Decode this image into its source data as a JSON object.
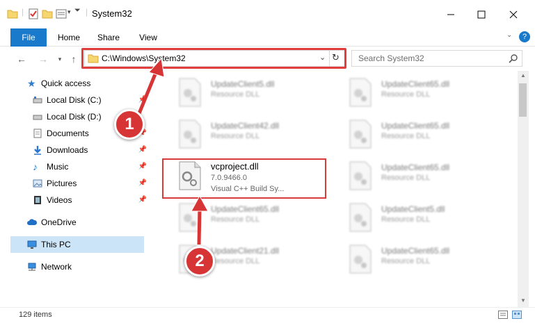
{
  "window": {
    "title": "System32"
  },
  "ribbon": {
    "tabs": [
      "File",
      "Home",
      "Share",
      "View"
    ]
  },
  "address": {
    "path": "C:\\Windows\\System32"
  },
  "search": {
    "placeholder": "Search System32"
  },
  "sidebar": {
    "items": [
      {
        "label": "Quick access"
      },
      {
        "label": "Local Disk (C:)"
      },
      {
        "label": "Local Disk (D:)"
      },
      {
        "label": "Documents"
      },
      {
        "label": "Downloads"
      },
      {
        "label": "Music"
      },
      {
        "label": "Pictures"
      },
      {
        "label": "Videos"
      },
      {
        "label": "OneDrive"
      },
      {
        "label": "This PC"
      },
      {
        "label": "Network"
      }
    ]
  },
  "files": {
    "left": [
      {
        "name": "UpdateClient5.dll",
        "desc": "Resource DLL"
      },
      {
        "name": "UpdateClient42.dll",
        "desc": "Resource DLL"
      },
      {
        "name": "vcproject.dll",
        "version": "7.0.9466.0",
        "desc": "Visual C++ Build Sy..."
      },
      {
        "name": "UpdateClient65.dll",
        "desc": "Resource DLL"
      },
      {
        "name": "UpdateClient21.dll",
        "desc": "Resource DLL"
      }
    ],
    "right": [
      {
        "name": "UpdateClient65.dll",
        "desc": "Resource DLL"
      },
      {
        "name": "UpdateClient65.dll",
        "desc": "Resource DLL"
      },
      {
        "name": "UpdateClient65.dll",
        "desc": "Resource DLL"
      },
      {
        "name": "UpdateClient5.dll",
        "desc": "Resource DLL"
      },
      {
        "name": "UpdateClient65.dll",
        "desc": "Resource DLL"
      }
    ]
  },
  "status": {
    "items_count": "129 items"
  },
  "annotations": {
    "step1": "1",
    "step2": "2"
  },
  "colors": {
    "accent": "#1979ca",
    "highlight": "#d93a3a"
  }
}
